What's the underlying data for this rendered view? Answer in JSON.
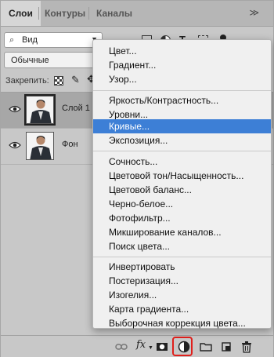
{
  "tabs": [
    {
      "label": "Слои",
      "active": true
    },
    {
      "label": "Контуры",
      "active": false
    },
    {
      "label": "Каналы",
      "active": false
    }
  ],
  "filter": {
    "label": "Вид"
  },
  "blend_mode": "Обычные",
  "lock_label": "Закрепить:",
  "layers": [
    {
      "name": "Слой 1",
      "selected": true
    },
    {
      "name": "Фон",
      "selected": false
    }
  ],
  "menu": {
    "groups": [
      [
        {
          "label": "Цвет..."
        },
        {
          "label": "Градиент..."
        },
        {
          "label": "Узор..."
        }
      ],
      [
        {
          "label": "Яркость/Контрастность..."
        },
        {
          "label": "Уровни..."
        },
        {
          "label": "Кривые...",
          "highlighted": true
        },
        {
          "label": "Экспозиция..."
        }
      ],
      [
        {
          "label": "Сочность..."
        },
        {
          "label": "Цветовой тон/Насыщенность..."
        },
        {
          "label": "Цветовой баланс..."
        },
        {
          "label": "Черно-белое..."
        },
        {
          "label": "Фотофильтр..."
        },
        {
          "label": "Микширование каналов..."
        },
        {
          "label": "Поиск цвета..."
        }
      ],
      [
        {
          "label": "Инвертировать"
        },
        {
          "label": "Постеризация..."
        },
        {
          "label": "Изогелия..."
        },
        {
          "label": "Карта градиента..."
        },
        {
          "label": "Выборочная коррекция цвета..."
        }
      ]
    ]
  },
  "toolbar": {
    "fx_label": "fx"
  },
  "colors": {
    "highlight": "#3d7fd6",
    "annotation": "#e0201c"
  }
}
